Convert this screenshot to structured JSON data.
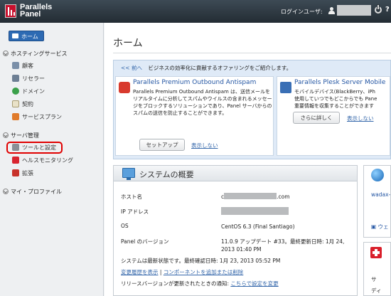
{
  "header": {
    "logo_line1": "Parallels",
    "logo_line2": "Panel",
    "login_label": "ログインユーザ:"
  },
  "sidebar": {
    "home": "ホーム",
    "sections": [
      {
        "title": "ホスティングサービス",
        "items": [
          "顧客",
          "リセラー",
          "ドメイン",
          "契約",
          "サービスプラン"
        ]
      },
      {
        "title": "サーバ管理",
        "items": [
          "ツールと設定",
          "ヘルスモニタリング",
          "拡張"
        ]
      },
      {
        "title": "マイ・プロファイル",
        "items": []
      }
    ]
  },
  "main": {
    "title": "ホーム",
    "promo": {
      "prev": "<< 前へ",
      "heading": "ビジネスの効率化に貢献するオファリングをご紹介します。",
      "card1": {
        "title": "Parallels Premium Outbound Antispam",
        "body": "Parallels Premium Outbound Antispam は、送信メールをリアルタイムに分析してスパムやウイルスの含まれるメッセージをブロックするソリューションであり、Panel サーバからのスパムの送信を防止することができます。",
        "button": "セットアップ",
        "dismiss": "表示しない"
      },
      "card2": {
        "title": "Parallels Plesk Server Mobile",
        "body_lines": [
          "モバイルデバイス(BlackBerry、iPh",
          "使用していつでもどこからでも Pane",
          "重要情報を収集することができます"
        ],
        "button": "さらに詳しく",
        "dismiss": "表示しない"
      }
    },
    "system": {
      "title": "システムの概要",
      "host_label": "ホスト名",
      "host_prefix": "c",
      "host_suffix": ".com",
      "ip_label": "IP アドレス",
      "os_label": "OS",
      "os_value": "CentOS 6.3 (Final Santiago)",
      "panel_label": "Panel のバージョン",
      "panel_value": "11.0.9 アップデート #33。最終更新日時: 1月 24, 2013 01:40 PM",
      "status_line": "システムは最新状態です。最終確認日時: 1月 23, 2013 05:52 PM",
      "history_link": "変更履歴を表示",
      "sep": "|",
      "components_link": "コンポーネントを追加または削除",
      "notify_prefix": "リリースバージョンが更新されたときの通知: ",
      "notify_link": "こちらで設定を変更"
    },
    "right": {
      "domain_text": "wadax-",
      "link_text": "ウェ",
      "item1": "サ",
      "item2": "ディ"
    }
  }
}
